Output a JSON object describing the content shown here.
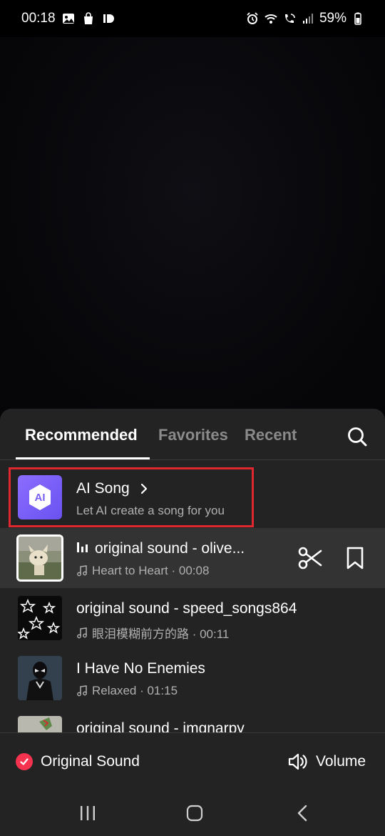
{
  "status": {
    "time": "00:18",
    "battery": "59%",
    "left_icons": [
      "image-icon",
      "shopping-bag-icon",
      "id-icon"
    ],
    "right_icons": [
      "alarm-icon",
      "wifi-icon",
      "wifi-call-icon",
      "signal-icon",
      "battery-icon"
    ]
  },
  "tabs": {
    "recommended": "Recommended",
    "favorites": "Favorites",
    "recent": "Recent",
    "active": "recommended"
  },
  "ai_song": {
    "badge": "AI",
    "title": "AI Song",
    "subtitle": "Let AI create a song for you"
  },
  "songs": [
    {
      "title": "original sound - olive...",
      "meta": "Heart to Heart · 00:08",
      "selected": true
    },
    {
      "title": "original sound - speed_songs864",
      "meta": "眼泪模糊前方的路 · 00:11",
      "selected": false
    },
    {
      "title": "I Have No Enemies",
      "meta": "Relaxed · 01:15",
      "selected": false
    },
    {
      "title": "original sound - imgnarpy",
      "meta": "",
      "selected": false
    }
  ],
  "bottom": {
    "original_sound": "Original Sound",
    "volume": "Volume"
  },
  "colors": {
    "sheet_bg": "#232323",
    "selected_row": "#333333",
    "accent_red": "#f5334f",
    "highlight_box": "#e0262e",
    "ai_purple": "#7a5ff5"
  }
}
